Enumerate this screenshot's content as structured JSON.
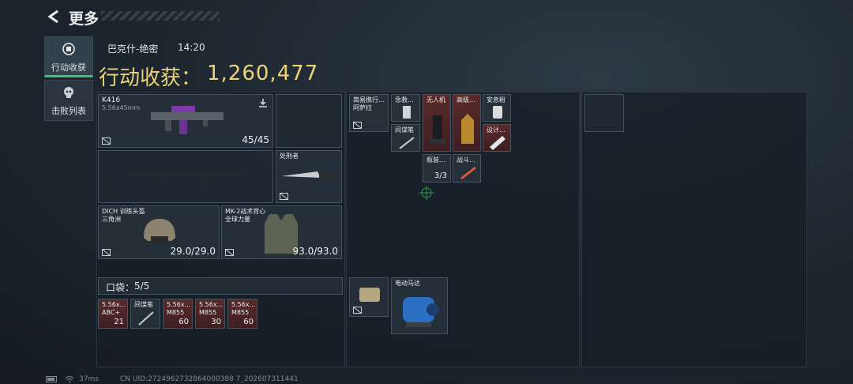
{
  "header": {
    "title": "更多"
  },
  "tabs": [
    {
      "label": "行动收获",
      "icon": "harvest-icon",
      "active": true
    },
    {
      "label": "击败列表",
      "icon": "skull-icon",
      "active": false
    }
  ],
  "match": {
    "map": "巴克什-绝密",
    "time": "14:20"
  },
  "harvest": {
    "label": "行动收获：",
    "value": "1,260,477"
  },
  "equipment": {
    "primary": {
      "name": "K416",
      "caliber": "5.56x45mm",
      "ammo": "45/45"
    },
    "melee": {
      "name": "处刑者"
    },
    "helmet": {
      "name": "DICH 训练头盔",
      "faction": "三角洲",
      "durability": "29.0/29.0"
    },
    "armor": {
      "name": "MK-2战术背心",
      "faction": "全球力量",
      "durability": "93.0/93.0"
    }
  },
  "pocket": {
    "label": "口袋：",
    "value": "5/5"
  },
  "pocket_items": [
    {
      "name": "5.56x...",
      "sub": "ABC+",
      "count": "21"
    },
    {
      "name": "间谍笔",
      "sub": "",
      "count": ""
    },
    {
      "name": "5.56x...",
      "sub": "M855",
      "count": "60"
    },
    {
      "name": "5.56x...",
      "sub": "M855",
      "count": "30"
    },
    {
      "name": "5.56x...",
      "sub": "M855",
      "count": "60"
    }
  ],
  "backpack_items": [
    {
      "name": "简易携行...",
      "sub": "阿萨拉"
    },
    {
      "name": "急救..."
    },
    {
      "name": "间谍笔"
    },
    {
      "name": "无人机"
    },
    {
      "name": "高级..."
    },
    {
      "name": "安息粉"
    },
    {
      "name": "设计..."
    },
    {
      "name": "瓶装...",
      "count": "3/3"
    },
    {
      "name": "战斗..."
    },
    {
      "name": "电动马达"
    }
  ],
  "footer": {
    "ping": "37ms",
    "uid": "CN UID:2724962732864000388 7_202607311441"
  },
  "colors": {
    "accent_gold": "#ecd27a",
    "active_tab": "#39c37d",
    "rare_red": "#5a2a2a"
  }
}
